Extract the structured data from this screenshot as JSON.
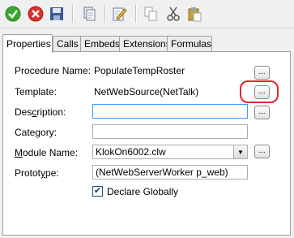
{
  "toolbar": {
    "buttons": [
      {
        "name": "ok-icon",
        "color": "#3aa830"
      },
      {
        "name": "cancel-icon",
        "color": "#d9322d"
      },
      {
        "name": "save-icon",
        "color": "#3c5a98"
      },
      {
        "name": "copy-document-icon",
        "color": "#6e7c91"
      },
      {
        "name": "edit-icon",
        "color": "#e8b64a"
      },
      {
        "name": "copy-icon",
        "color": "#9aa3ad"
      },
      {
        "name": "cut-icon",
        "color": "#555555"
      },
      {
        "name": "paste-icon",
        "color": "#c8a24a"
      }
    ]
  },
  "tabs": [
    {
      "label": "Properties",
      "active": true
    },
    {
      "label": "Calls"
    },
    {
      "label": "Embeds"
    },
    {
      "label": "Extensions"
    },
    {
      "label": "Formulas"
    }
  ],
  "form": {
    "procedure_name_label": "Procedure Name:",
    "procedure_name_value": "PopulateTempRoster",
    "template_label": "Template:",
    "template_value": "NetWebSource(NetTalk)",
    "description_label_pre": "Des",
    "description_label_u": "c",
    "description_label_post": "ription:",
    "description_value": "",
    "category_label": "Category:",
    "category_value": "",
    "module_label_pre": "",
    "module_label_u": "M",
    "module_label_post": "odule Name:",
    "module_value": "KlokOn6002.clw",
    "prototype_label_pre": "Protot",
    "prototype_label_u": "y",
    "prototype_label_post": "pe:",
    "prototype_value": "(NetWebServerWorker p_web)",
    "declare_globally_label": "Declare Globally",
    "declare_globally_checked": true,
    "ellipsis": "..."
  },
  "highlight_color": "#e3262b"
}
